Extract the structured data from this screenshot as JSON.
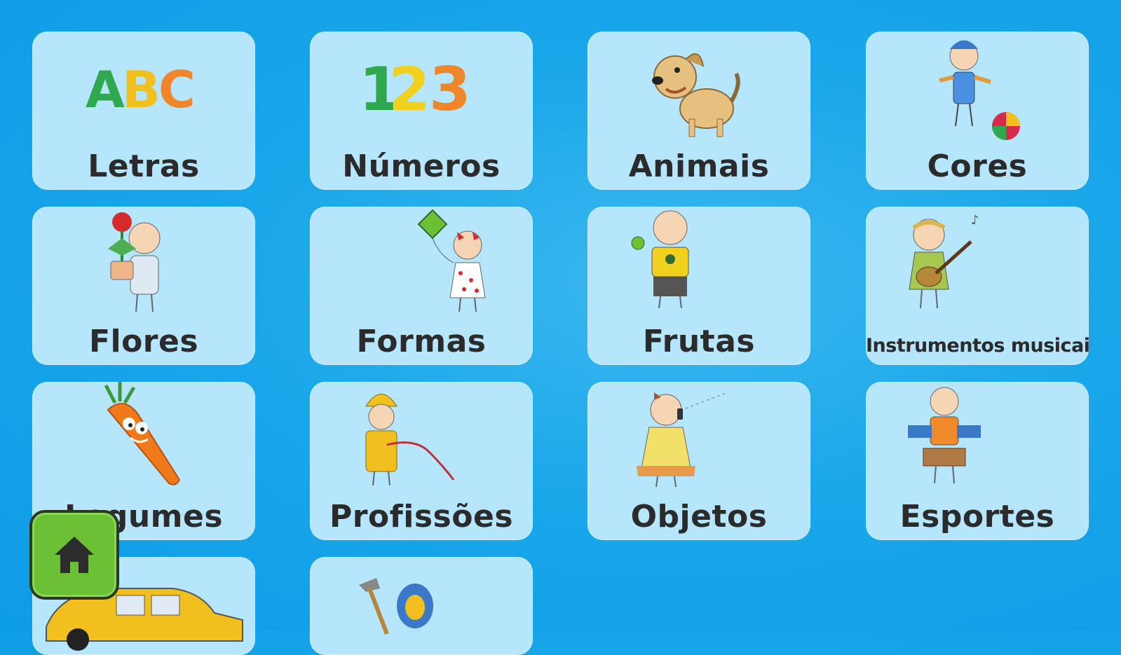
{
  "app": {
    "categories": [
      {
        "label": "Letras",
        "icon": "abc-letters-icon"
      },
      {
        "label": "Números",
        "icon": "numbers-123-icon"
      },
      {
        "label": "Animais",
        "icon": "dog-icon"
      },
      {
        "label": "Cores",
        "icon": "child-with-ball-icon"
      },
      {
        "label": "Flores",
        "icon": "child-with-flower-icon"
      },
      {
        "label": "Formas",
        "icon": "girl-with-kite-icon"
      },
      {
        "label": "Frutas",
        "icon": "boy-with-apple-icon"
      },
      {
        "label": "Instrumentos musicais",
        "icon": "girl-with-guitar-icon"
      },
      {
        "label": "Legumes",
        "icon": "carrot-icon"
      },
      {
        "label": "Profissões",
        "icon": "firefighter-icon"
      },
      {
        "label": "Objetos",
        "icon": "girl-with-phone-icon"
      },
      {
        "label": "Esportes",
        "icon": "child-with-drum-icon"
      },
      {
        "label": "",
        "icon": "car-icon"
      },
      {
        "label": "",
        "icon": "tools-icon"
      }
    ],
    "home_button": {
      "icon": "home-icon"
    },
    "colors": {
      "background": "#1aa7ea",
      "tile": "#b5e6fb",
      "home": "#6cc035"
    }
  }
}
